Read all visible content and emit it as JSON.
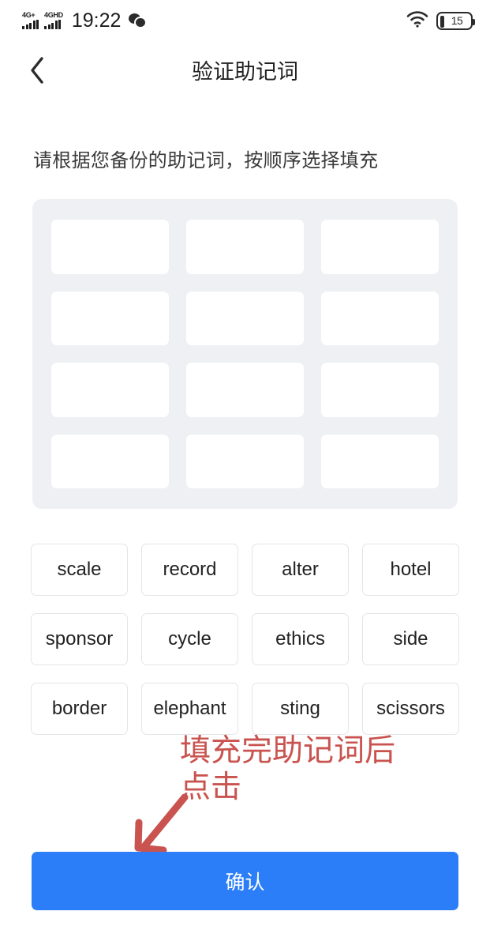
{
  "status_bar": {
    "network_primary": "4G+",
    "network_secondary": "4GHD",
    "time": "19:22",
    "wechat_icon": "wechat-icon",
    "wifi_icon": "wifi-icon",
    "battery_level": "15"
  },
  "header": {
    "back_icon": "chevron-left-icon",
    "title": "验证助记词"
  },
  "instruction": "请根据您备份的助记词，按顺序选择填充",
  "slots": {
    "count": 12,
    "values": [
      "",
      "",
      "",
      "",
      "",
      "",
      "",
      "",
      "",
      "",
      "",
      ""
    ]
  },
  "word_bank": [
    "scale",
    "record",
    "alter",
    "hotel",
    "sponsor",
    "cycle",
    "ethics",
    "side",
    "border",
    "elephant",
    "sting",
    "scissors"
  ],
  "annotation": {
    "text": "填充完助记词后\n点击",
    "color": "#c9534f"
  },
  "confirm_button": {
    "label": "确认",
    "color": "#2b7ef8"
  }
}
